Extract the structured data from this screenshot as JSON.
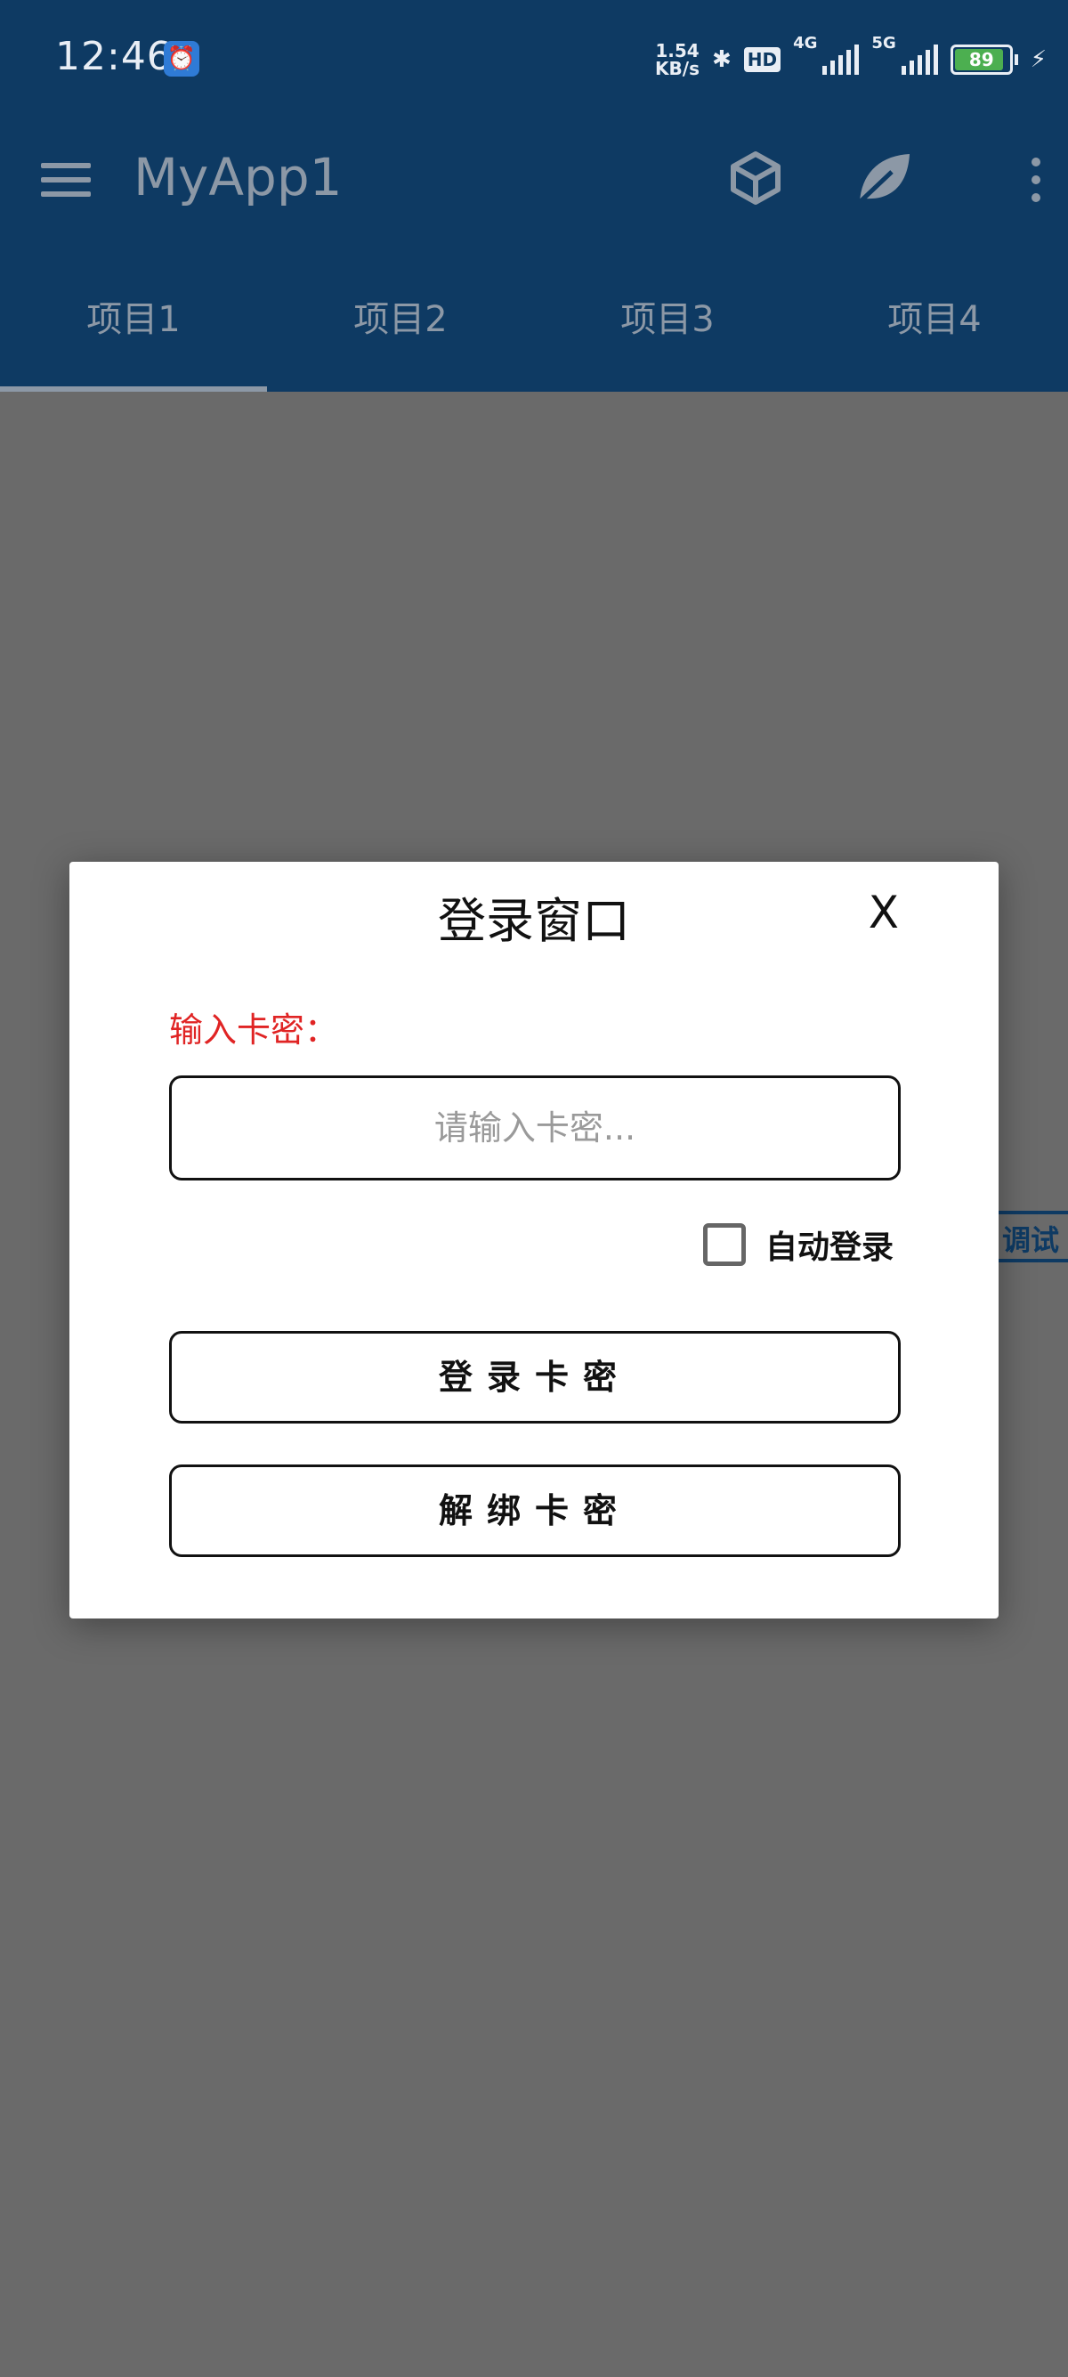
{
  "status_bar": {
    "time": "12:46",
    "notification_icon": "alarm-app-icon",
    "net_speed_value": "1.54",
    "net_speed_unit": "KB/s",
    "hd_label": "HD",
    "network_1": "4G",
    "network_2": "5G",
    "battery_percent": "89"
  },
  "app_bar": {
    "title": "MyApp1",
    "icons": [
      "menu-icon",
      "cube-icon",
      "leaf-icon",
      "more-vert-icon"
    ]
  },
  "tabs": [
    {
      "label": "项目1",
      "selected": true
    },
    {
      "label": "项目2",
      "selected": false
    },
    {
      "label": "项目3",
      "selected": false
    },
    {
      "label": "项目4",
      "selected": false
    }
  ],
  "side_tag": {
    "label": "调试"
  },
  "dialog": {
    "title": "登录窗口",
    "close_label": "X",
    "field_label": "输入卡密：",
    "input_value": "",
    "input_placeholder": "请输入卡密...",
    "auto_login_label": "自动登录",
    "auto_login_checked": false,
    "login_button": "登录卡密",
    "unbind_button": "解绑卡密"
  },
  "colors": {
    "header_bg": "#0e3a63",
    "scrim": "#6a6a6a",
    "label_red": "#e02424",
    "battery_green": "#4caf50"
  }
}
